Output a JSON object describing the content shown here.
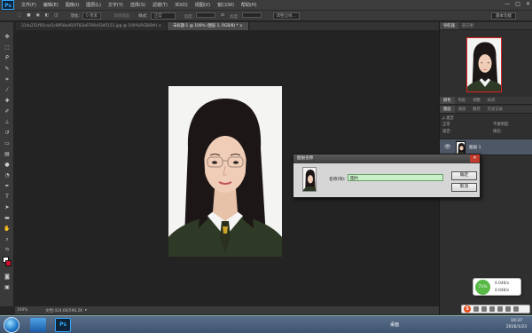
{
  "app": {
    "logo": "Ps"
  },
  "menu": [
    "文件(F)",
    "编辑(E)",
    "图像(I)",
    "图层(L)",
    "文字(Y)",
    "选择(S)",
    "滤镜(T)",
    "3D(D)",
    "视图(V)",
    "窗口(W)",
    "帮助(H)"
  ],
  "window_controls": [
    "—",
    "□",
    "✕"
  ],
  "options": {
    "feather_label": "羽化:",
    "feather_value": "0 像素",
    "antialias": "消除锯齿",
    "style_label": "样式:",
    "style_value": "正常",
    "width_label": "宽度:",
    "height_label": "高度:",
    "refine_edge": "调整边缘...",
    "workspace": "基本功能"
  },
  "tabs": [
    {
      "label": "314a251f95cad1c8958a492f783e6709c93d5151.jpg @ 100%(RGB/8#)",
      "close": "×"
    },
    {
      "label": "未标题-1 @ 100% (图层 1, RGB/8) *",
      "close": "×"
    }
  ],
  "status": {
    "zoom": "100%",
    "doc": "文档:414.6K/596.2K"
  },
  "panels": {
    "top_tabs": [
      "导航器",
      "直方图"
    ],
    "mid_tabs": [
      "颜色",
      "色板",
      "调整",
      "样式"
    ],
    "layer_tabs": [
      "图层",
      "通道",
      "路径",
      "历史记录"
    ],
    "kind_label": "ρ 类型",
    "blend_mode": "正常",
    "opacity_label": "不透明度:",
    "lock_label": "锁定:",
    "fill_label": "填充:",
    "layer_name": "图层 1"
  },
  "dialog": {
    "title": "图层名称",
    "name_label": "名称(N):",
    "name_value": "图片",
    "ok": "确定",
    "cancel": "取消",
    "close": "✕"
  },
  "taskbar": {
    "lang": "桌面",
    "time": "10:37",
    "date": "2016/1/23"
  },
  "net_widget": {
    "percent": "71%",
    "up": "0.04K/s",
    "down": "0.04K/s"
  },
  "ime": {
    "logo": "S"
  }
}
